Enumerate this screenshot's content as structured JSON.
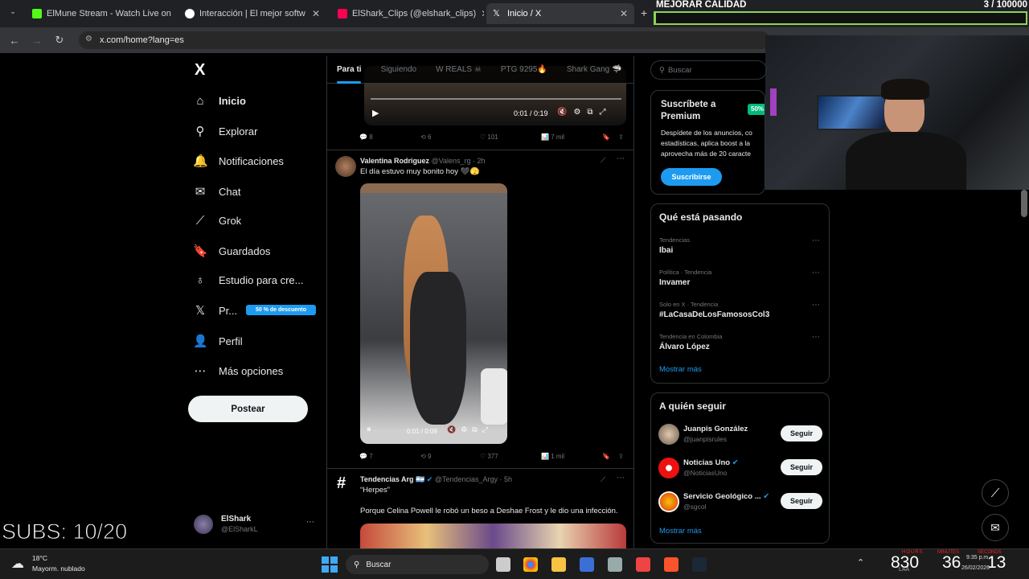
{
  "browser": {
    "tabs": [
      {
        "title": "ElMune Stream - Watch Live on",
        "color": "#53fc18"
      },
      {
        "title": "Interacción | El mejor softw",
        "color": "#ffffff"
      },
      {
        "title": "ElShark_Clips (@elshark_clips)",
        "color": "#ff0050"
      },
      {
        "title": "Inicio / X",
        "color": "#ffffff"
      }
    ],
    "url": "x.com/home?lang=es"
  },
  "overlay": {
    "quality_label": "MEJORAR CALIDAD",
    "quality_count": "3 / 100000",
    "progress_fraction": 3e-05,
    "subs": "SUBS: 10/20"
  },
  "sidebar": {
    "logo": "X",
    "items": [
      {
        "label": "Inicio",
        "icon": "home-icon",
        "glyph": "⌂"
      },
      {
        "label": "Explorar",
        "icon": "search-icon",
        "glyph": "⚲"
      },
      {
        "label": "Notificaciones",
        "icon": "bell-icon",
        "glyph": "🔔"
      },
      {
        "label": "Chat",
        "icon": "mail-icon",
        "glyph": "✉"
      },
      {
        "label": "Grok",
        "icon": "grok-icon",
        "glyph": "⟋"
      },
      {
        "label": "Guardados",
        "icon": "bookmark-icon",
        "glyph": "🔖"
      },
      {
        "label": "Estudio para cre...",
        "icon": "flask-icon",
        "glyph": "♁"
      },
      {
        "label": "Pr...",
        "icon": "x-premium-icon",
        "glyph": "𝕏"
      },
      {
        "label": "Perfil",
        "icon": "person-icon",
        "glyph": "👤"
      },
      {
        "label": "Más opciones",
        "icon": "more-icon",
        "glyph": "⋯"
      }
    ],
    "premium_badge": "50 % de descuento",
    "post_button": "Postear",
    "account": {
      "name": "ElShark",
      "handle": "@ElSharkL"
    }
  },
  "feed": {
    "tabs": [
      "Para ti",
      "Siguiendo",
      "W REALS ☠",
      "PTG 9295🔥",
      "Shark Gang 🦈"
    ],
    "top_video": {
      "time": "0:01 / 0:19",
      "stats": [
        "8",
        "6",
        "101",
        "7 mil"
      ]
    },
    "post1": {
      "name": "Valentina Rodriguez",
      "handle": "@Valens_rg",
      "time": "· 2h",
      "text": "El día estuvo muy bonito hoy 🖤🫣",
      "video_time": "0:01 / 0:09",
      "stats": [
        "7",
        "9",
        "377",
        "1 mil"
      ]
    },
    "post2": {
      "name": "Tendencias Arg 🇦🇷",
      "handle": "@Tendencias_Argy",
      "time": "· 5h",
      "quote": "“Herpes”",
      "text": "Porque Celina Powell le robó un beso a Deshae Frost y le dio una infección."
    }
  },
  "right": {
    "search_placeholder": "Buscar",
    "premium": {
      "title": "Suscríbete a Premium",
      "badge": "50%",
      "text": "Despídete de los anuncios, co estadísticas, aplica boost a la aprovecha más de 20 caracte",
      "button": "Suscribirse"
    },
    "trends_title": "Qué está pasando",
    "trends": [
      {
        "cat": "Tendencias",
        "name": "Ibai"
      },
      {
        "cat": "Política · Tendencia",
        "name": "Invamer"
      },
      {
        "cat": "Solo en X · Tendencia",
        "name": "#LaCasaDeLosFamososCol3"
      },
      {
        "cat": "Tendencia en Colombia",
        "name": "Álvaro López"
      }
    ],
    "show_more": "Mostrar más",
    "follow_title": "A quién seguir",
    "follow": [
      {
        "name": "Juanpis González",
        "handle": "@juanpisrules",
        "button": "Seguir"
      },
      {
        "name": "Noticias Uno",
        "handle": "@NoticiasUno",
        "button": "Seguir"
      },
      {
        "name": "Servicio Geológico ...",
        "handle": "@sgcol",
        "button": "Seguir"
      }
    ],
    "follow_more": "Mostrar más"
  },
  "taskbar": {
    "weather_temp": "18°C",
    "weather_desc": "Mayorm. nublado",
    "search": "Buscar",
    "clock_digits": [
      "830",
      "36",
      "13"
    ],
    "clock_labels": [
      "HOURS",
      "MINUTES",
      "SECONDS"
    ],
    "time": "9:35 p.m.",
    "date": "26/02/2026",
    "lang": "LAA"
  }
}
